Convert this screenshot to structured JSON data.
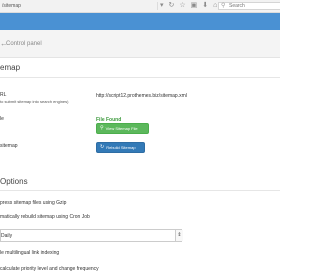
{
  "browser": {
    "url": "/sitemap",
    "search_placeholder": "Search",
    "icons": [
      "dropdown-arrow-icon",
      "refresh-icon",
      "star-icon",
      "clipboard-icon",
      "download-icon",
      "home-icon"
    ]
  },
  "breadcrumb": {
    "arrow": "←",
    "label": "Control panel"
  },
  "sitemap_section": {
    "title": "emap",
    "url_label": "RL",
    "url_sub": "to submit sitemap into search engines)",
    "url_value": "http://script12.prothemes.biz/sitemap.xml",
    "file_label": "le",
    "file_status": "File Found",
    "view_button": "View Sitemap File",
    "rebuild_label": "sitemap",
    "rebuild_button": "Rebuild Sitemap"
  },
  "options_section": {
    "title": "Options",
    "gzip_label": "press sitemap files using Gzip",
    "cron_label": "matically rebuild sitemap using Cron Job",
    "frequency_value": "Daily",
    "multilingual_label": "le multilingual link indexing",
    "priority_label": "calculate priority level and change frequency"
  }
}
